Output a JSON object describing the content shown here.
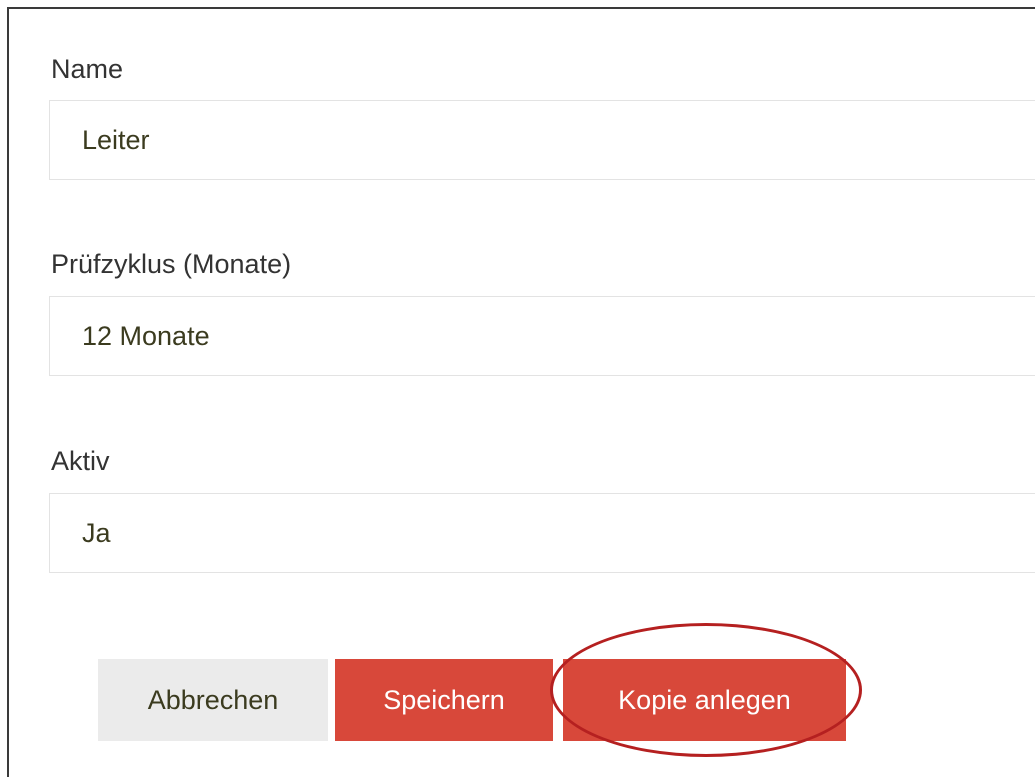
{
  "form": {
    "fields": [
      {
        "label": "Name",
        "value": "Leiter"
      },
      {
        "label": "Prüfzyklus (Monate)",
        "value": "12 Monate"
      },
      {
        "label": "Aktiv",
        "value": "Ja"
      }
    ]
  },
  "buttons": {
    "cancel": "Abbrechen",
    "save": "Speichern",
    "copy": "Kopie anlegen"
  },
  "colors": {
    "primary": "#d8483a",
    "secondary": "#ebebeb",
    "highlight": "#b52020",
    "value_text": "#3b3b1f"
  }
}
